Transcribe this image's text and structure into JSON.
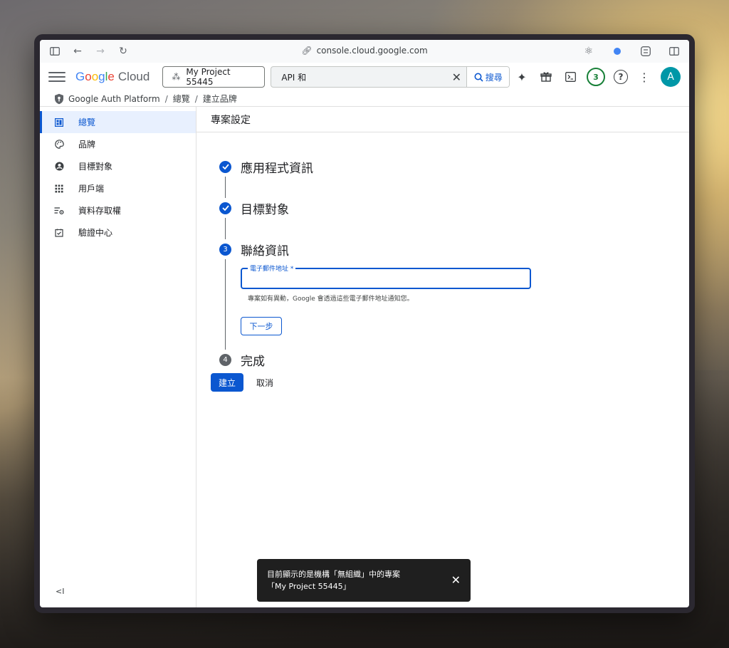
{
  "browser": {
    "url": "console.cloud.google.com"
  },
  "topbar": {
    "logo_parts": [
      "G",
      "o",
      "o",
      "g",
      "l",
      "e"
    ],
    "logo_suffix": "Cloud",
    "project_label": "My Project 55445",
    "search_value": "API 和",
    "search_button": "搜尋",
    "notification_count": "3",
    "avatar_letter": "A"
  },
  "breadcrumb": {
    "items": [
      "Google Auth Platform",
      "總覽",
      "建立品牌"
    ]
  },
  "sidebar": {
    "items": [
      {
        "label": "總覽",
        "icon": "dashboard-icon",
        "active": true
      },
      {
        "label": "品牌",
        "icon": "palette-icon",
        "active": false
      },
      {
        "label": "目標對象",
        "icon": "person-icon",
        "active": false
      },
      {
        "label": "用戶端",
        "icon": "apps-icon",
        "active": false
      },
      {
        "label": "資料存取權",
        "icon": "data-access-icon",
        "active": false
      },
      {
        "label": "驗證中心",
        "icon": "verification-icon",
        "active": false
      }
    ],
    "collapse_label": "<I"
  },
  "content": {
    "title": "專案設定",
    "steps": [
      {
        "number": "1",
        "title": "應用程式資訊",
        "state": "done"
      },
      {
        "number": "2",
        "title": "目標對象",
        "state": "done"
      },
      {
        "number": "3",
        "title": "聯絡資訊",
        "state": "active"
      },
      {
        "number": "4",
        "title": "完成",
        "state": "todo"
      }
    ],
    "email_label": "電子郵件地址 *",
    "email_value": "",
    "email_hint": "專案如有異動，Google 會透過這些電子郵件地址通知您。",
    "next_button": "下一步",
    "create_button": "建立",
    "cancel_button": "取消"
  },
  "snackbar": {
    "line1": "目前顯示的是機構「無組織」中的專案",
    "line2": "「My Project 55445」"
  },
  "colors": {
    "accent": "#0b57d0",
    "avatar": "#0097a7",
    "badge": "#188038"
  }
}
